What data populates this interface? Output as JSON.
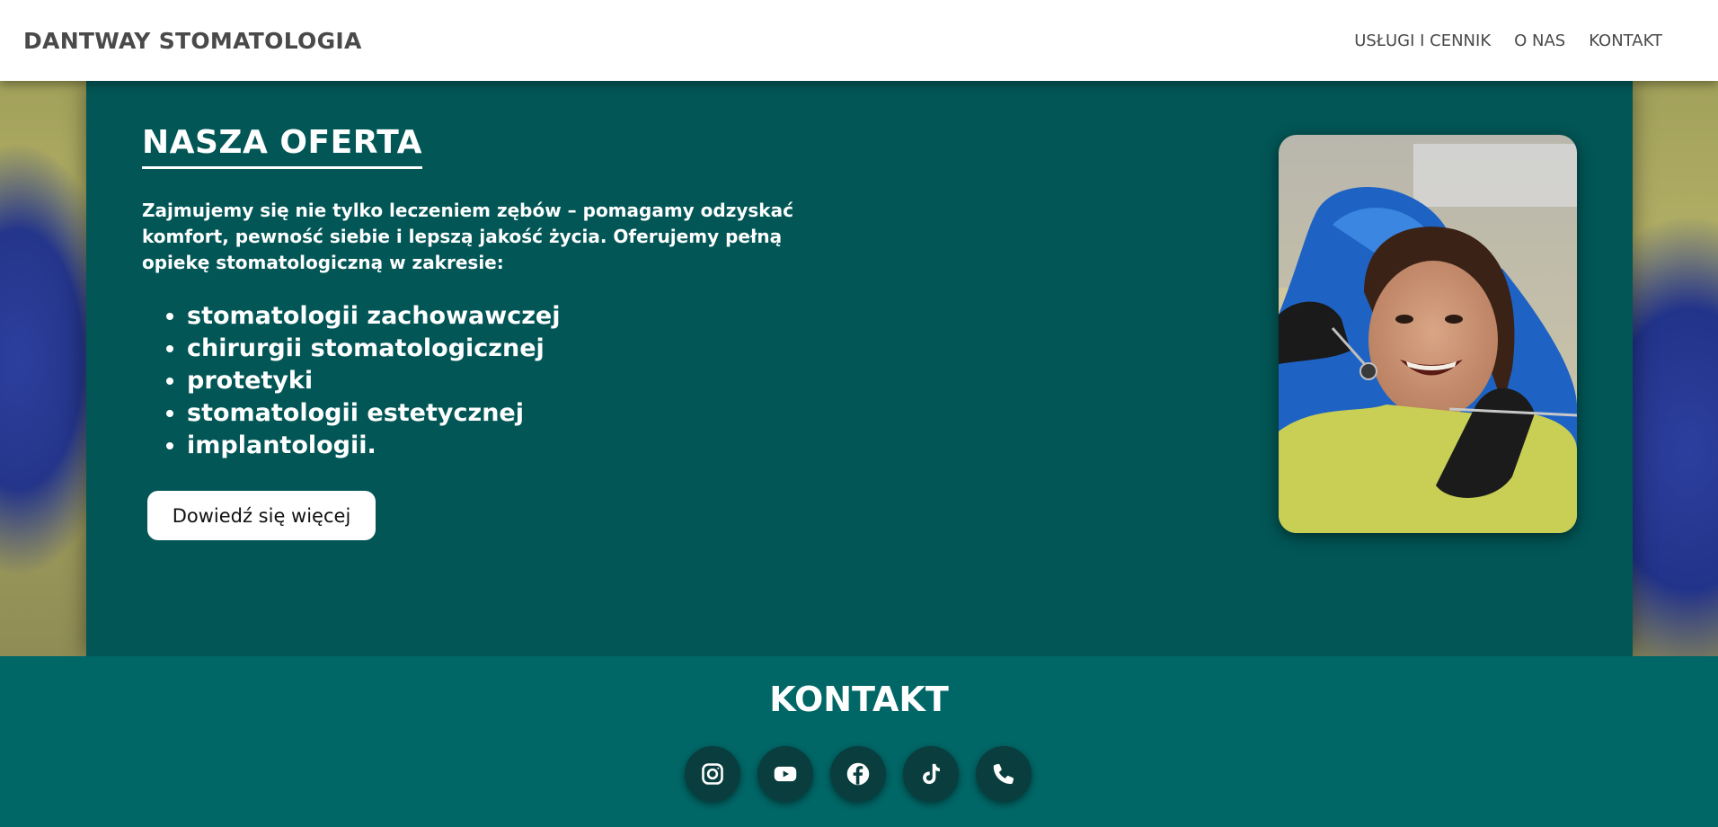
{
  "header": {
    "logo": "DANTWAY STOMATOLOGIA",
    "nav": [
      {
        "label": "USŁUGI I CENNIK"
      },
      {
        "label": "O NAS"
      },
      {
        "label": "KONTAKT"
      }
    ]
  },
  "offer": {
    "title": "NASZA OFERTA",
    "intro": "Zajmujemy się nie tylko leczeniem zębów – pomagamy odzyskać komfort, pewność siebie i lepszą jakość życia. Oferujemy pełną opiekę stomatologiczną w zakresie:",
    "items": [
      "stomatologii zachowawczej",
      "chirurgii stomatologicznej",
      "protetyki",
      "stomatologii estetycznej",
      "implantologii."
    ],
    "button": "Dowiedź się więcej"
  },
  "contact": {
    "title": "KONTAKT",
    "socials": [
      {
        "icon": "instagram-icon"
      },
      {
        "icon": "youtube-icon"
      },
      {
        "icon": "facebook-icon"
      },
      {
        "icon": "tiktok-icon"
      },
      {
        "icon": "phone-icon"
      }
    ]
  },
  "colors": {
    "panel": "#025656",
    "contact_bg": "#006666",
    "social_bg": "#0a3d3d",
    "header_text": "#4a4a4a"
  }
}
